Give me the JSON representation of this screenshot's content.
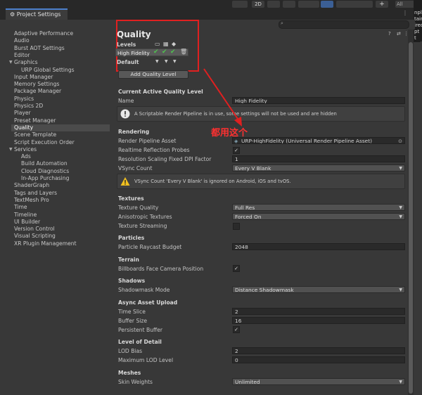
{
  "window": {
    "tab_title": "Project Settings",
    "right_fragments": "npl\ntain\nired\npt\nt\nnpl"
  },
  "toolbar": {
    "twod_label": "2D",
    "all_label": "All"
  },
  "sidebar": {
    "items": [
      {
        "label": "Adaptive Performance",
        "indent": 0
      },
      {
        "label": "Audio",
        "indent": 0
      },
      {
        "label": "Burst AOT Settings",
        "indent": 0
      },
      {
        "label": "Editor",
        "indent": 0
      },
      {
        "label": "Graphics",
        "indent": 0,
        "expanded": true
      },
      {
        "label": "URP Global Settings",
        "indent": 1
      },
      {
        "label": "Input Manager",
        "indent": 0
      },
      {
        "label": "Memory Settings",
        "indent": 0
      },
      {
        "label": "Package Manager",
        "indent": 0
      },
      {
        "label": "Physics",
        "indent": 0
      },
      {
        "label": "Physics 2D",
        "indent": 0
      },
      {
        "label": "Player",
        "indent": 0
      },
      {
        "label": "Preset Manager",
        "indent": 0
      },
      {
        "label": "Quality",
        "indent": 0,
        "selected": true
      },
      {
        "label": "Scene Template",
        "indent": 0
      },
      {
        "label": "Script Execution Order",
        "indent": 0
      },
      {
        "label": "Services",
        "indent": 0,
        "expanded": true
      },
      {
        "label": "Ads",
        "indent": 1
      },
      {
        "label": "Build Automation",
        "indent": 1
      },
      {
        "label": "Cloud Diagnostics",
        "indent": 1
      },
      {
        "label": "In-App Purchasing",
        "indent": 1
      },
      {
        "label": "ShaderGraph",
        "indent": 0
      },
      {
        "label": "Tags and Layers",
        "indent": 0
      },
      {
        "label": "TextMesh Pro",
        "indent": 0
      },
      {
        "label": "Time",
        "indent": 0
      },
      {
        "label": "Timeline",
        "indent": 0
      },
      {
        "label": "UI Builder",
        "indent": 0
      },
      {
        "label": "Version Control",
        "indent": 0
      },
      {
        "label": "Visual Scripting",
        "indent": 0
      },
      {
        "label": "XR Plugin Management",
        "indent": 0
      }
    ]
  },
  "quality": {
    "title": "Quality",
    "levels_label": "Levels",
    "level_name": "High Fidelity",
    "default_label": "Default",
    "add_button": "Add Quality Level"
  },
  "current": {
    "section": "Current Active Quality Level",
    "name_label": "Name",
    "name_value": "High Fidelity",
    "info": "A Scriptable Render Pipeline is in use, some settings will not be used and are hidden"
  },
  "rendering": {
    "section": "Rendering",
    "pipeline_label": "Render Pipeline Asset",
    "pipeline_value": "URP-HighFidelity (Universal Render Pipeline Asset)",
    "reflection_label": "Realtime Reflection Probes",
    "dpi_label": "Resolution Scaling Fixed DPI Factor",
    "dpi_value": "1",
    "vsync_label": "VSync Count",
    "vsync_value": "Every V Blank",
    "vsync_warning": "VSync Count 'Every V Blank' is ignored on Android, iOS and tvOS."
  },
  "annotation": "都用这个",
  "textures": {
    "section": "Textures",
    "quality_label": "Texture Quality",
    "quality_value": "Full Res",
    "aniso_label": "Anisotropic Textures",
    "aniso_value": "Forced On",
    "streaming_label": "Texture Streaming"
  },
  "particles": {
    "section": "Particles",
    "budget_label": "Particle Raycast Budget",
    "budget_value": "2048"
  },
  "terrain": {
    "section": "Terrain",
    "billboards_label": "Billboards Face Camera Position"
  },
  "shadows": {
    "section": "Shadows",
    "mask_label": "Shadowmask Mode",
    "mask_value": "Distance Shadowmask"
  },
  "async": {
    "section": "Async Asset Upload",
    "slice_label": "Time Slice",
    "slice_value": "2",
    "buffer_label": "Buffer Size",
    "buffer_value": "16",
    "persistent_label": "Persistent Buffer"
  },
  "lod": {
    "section": "Level of Detail",
    "bias_label": "LOD Bias",
    "bias_value": "2",
    "max_label": "Maximum LOD Level",
    "max_value": "0"
  },
  "meshes": {
    "section": "Meshes",
    "skin_label": "Skin Weights",
    "skin_value": "Unlimited"
  },
  "colors": {
    "accent": "#4c7fcc",
    "annotation_red": "#e02020",
    "check_green": "#4fc24f"
  }
}
